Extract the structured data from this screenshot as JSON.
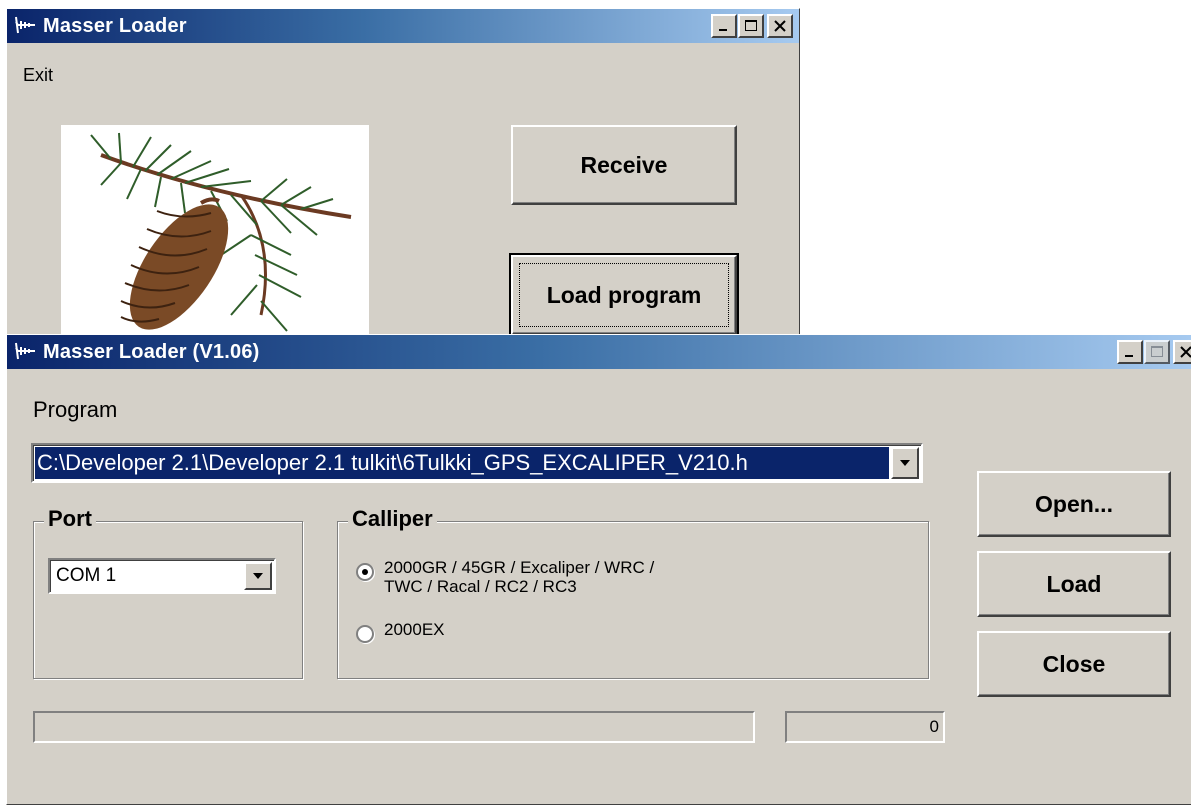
{
  "back_window": {
    "title": "Masser Loader",
    "menu": {
      "exit_label": "Exit"
    },
    "receive_label": "Receive",
    "load_program_label": "Load program",
    "picture_icon": "pine-cone-icon"
  },
  "front_window": {
    "title": "Masser Loader (V1.06)",
    "program_label": "Program",
    "program_path": "C:\\Developer 2.1\\Developer 2.1 tulkit\\6Tulkki_GPS_EXCALIPER_V210.h",
    "port": {
      "title": "Port",
      "selected": "COM 1"
    },
    "calliper": {
      "title": "Calliper",
      "options": [
        {
          "line1": "2000GR / 45GR / Excaliper / WRC /",
          "line2": "TWC / Racal / RC2 / RC3",
          "selected": true
        },
        {
          "line1": "2000EX",
          "line2": "",
          "selected": false
        }
      ]
    },
    "buttons": {
      "open": "Open...",
      "load": "Load",
      "close": "Close"
    },
    "progress": 0,
    "counter": "0"
  },
  "colors": {
    "face": "#d4d0c8",
    "title_start": "#0a246a",
    "title_end": "#a6caf0",
    "selection": "#0a246a"
  }
}
